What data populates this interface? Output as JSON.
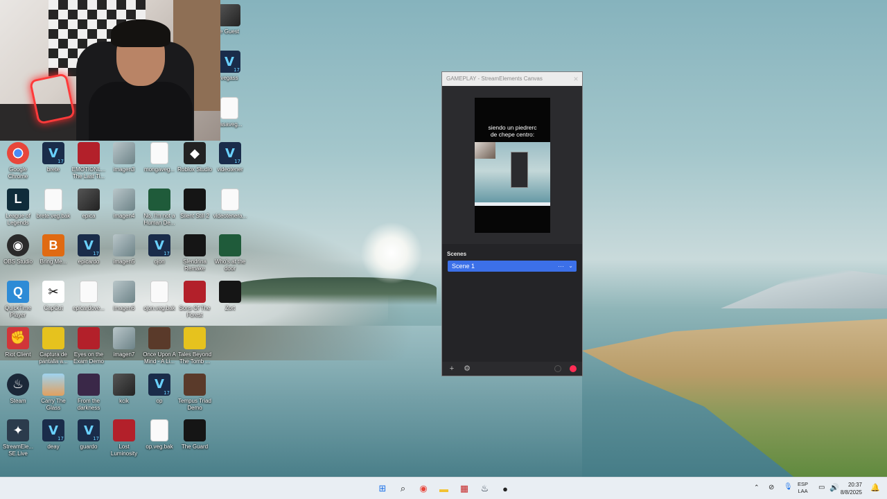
{
  "desktop": {
    "icons": [
      {
        "label": "Google Chrome",
        "kind": "chrome",
        "col": 0,
        "row": 0
      },
      {
        "label": "brete",
        "kind": "vegas",
        "col": 1,
        "row": 0
      },
      {
        "label": "EMOTIONL... The Last Ti...",
        "kind": "app-red",
        "col": 2,
        "row": 0
      },
      {
        "label": "imagen3",
        "kind": "thumb",
        "col": 3,
        "row": 0
      },
      {
        "label": "mongaveg...",
        "kind": "file",
        "col": 4,
        "row": 0
      },
      {
        "label": "Roblox Studio",
        "kind": "roblox",
        "col": 5,
        "row": 0
      },
      {
        "label": "videotener",
        "kind": "vegas",
        "col": 6,
        "row": 0
      },
      {
        "label": "League of Legends",
        "kind": "lol",
        "col": 0,
        "row": 1
      },
      {
        "label": "brete.veg.bak",
        "kind": "file",
        "col": 1,
        "row": 1
      },
      {
        "label": "epica",
        "kind": "thumb-dark",
        "col": 2,
        "row": 1
      },
      {
        "label": "imagen4",
        "kind": "thumb",
        "col": 3,
        "row": 1
      },
      {
        "label": "No, I'm not a Human De...",
        "kind": "app-green",
        "col": 4,
        "row": 1
      },
      {
        "label": "Silent Still 2",
        "kind": "app-black",
        "col": 5,
        "row": 1
      },
      {
        "label": "videotenera...",
        "kind": "file",
        "col": 6,
        "row": 1
      },
      {
        "label": "OBS Studio",
        "kind": "obs",
        "col": 0,
        "row": 2
      },
      {
        "label": "Bring Me...",
        "kind": "app-orange",
        "col": 1,
        "row": 2
      },
      {
        "label": "epicardo",
        "kind": "vegas",
        "col": 2,
        "row": 2
      },
      {
        "label": "imagen5",
        "kind": "thumb",
        "col": 3,
        "row": 2
      },
      {
        "label": "ojon",
        "kind": "vegas",
        "col": 4,
        "row": 2
      },
      {
        "label": "Slendrina Remake",
        "kind": "app-black",
        "col": 5,
        "row": 2
      },
      {
        "label": "Who's at the door",
        "kind": "app-green",
        "col": 6,
        "row": 2
      },
      {
        "label": "QuickTime Player",
        "kind": "quicktime",
        "col": 0,
        "row": 3
      },
      {
        "label": "CapCut",
        "kind": "capcut",
        "col": 1,
        "row": 3
      },
      {
        "label": "epicardove...",
        "kind": "file",
        "col": 2,
        "row": 3
      },
      {
        "label": "imagen6",
        "kind": "thumb",
        "col": 3,
        "row": 3
      },
      {
        "label": "ojon.veg.bak",
        "kind": "file",
        "col": 4,
        "row": 3
      },
      {
        "label": "Sons Of The Forest",
        "kind": "app-red",
        "col": 5,
        "row": 3
      },
      {
        "label": "Zort",
        "kind": "app-black",
        "col": 6,
        "row": 3
      },
      {
        "label": "Riot Client",
        "kind": "riot",
        "col": 0,
        "row": 4
      },
      {
        "label": "Captura de pantalla a...",
        "kind": "app-yellow",
        "col": 1,
        "row": 4
      },
      {
        "label": "Eyes on the Exam Demo",
        "kind": "app-red",
        "col": 2,
        "row": 4
      },
      {
        "label": "imagen7",
        "kind": "thumb",
        "col": 3,
        "row": 4
      },
      {
        "label": "Once Upon A Mind - A Li...",
        "kind": "app-brown",
        "col": 4,
        "row": 4
      },
      {
        "label": "Tales Beyond The Tomb ...",
        "kind": "app-yellow",
        "col": 5,
        "row": 4
      },
      {
        "label": "Steam",
        "kind": "steam",
        "col": 0,
        "row": 5
      },
      {
        "label": "Carry The Glass",
        "kind": "app-sky",
        "col": 1,
        "row": 5
      },
      {
        "label": "From the darkness",
        "kind": "app-purple",
        "col": 2,
        "row": 5
      },
      {
        "label": "kcik",
        "kind": "thumb-dark",
        "col": 3,
        "row": 5
      },
      {
        "label": "op",
        "kind": "vegas",
        "col": 4,
        "row": 5
      },
      {
        "label": "Tempus Triad Demo",
        "kind": "app-brown",
        "col": 5,
        "row": 5
      },
      {
        "label": "StreamEle... SE.Live",
        "kind": "selive",
        "col": 0,
        "row": 6
      },
      {
        "label": "deay",
        "kind": "vegas",
        "col": 1,
        "row": 6
      },
      {
        "label": "guardo",
        "kind": "vegas",
        "col": 2,
        "row": 6
      },
      {
        "label": "Lost Luminosity",
        "kind": "app-red",
        "col": 3,
        "row": 6
      },
      {
        "label": "op.veg.bak",
        "kind": "file",
        "col": 4,
        "row": 6
      },
      {
        "label": "The Guard",
        "kind": "app-black",
        "col": 5,
        "row": 6
      }
    ],
    "top_right_icons": [
      {
        "label": "e Guest",
        "kind": "thumb-dark"
      },
      {
        "label": "vegass",
        "kind": "vegas"
      },
      {
        "label": "gasaveg...",
        "kind": "file"
      }
    ]
  },
  "canvas_window": {
    "title": "GAMEPLAY - StreamElements Canvas",
    "close_glyph": "✕",
    "preview_caption_line1": "siendo un piedrerc",
    "preview_caption_line2": "de chepe centro:",
    "scenes_heading": "Scenes",
    "scenes": [
      {
        "name": "Scene 1",
        "selected": true
      }
    ],
    "scene_more_glyph": "···",
    "scene_chevron_glyph": "⌄",
    "add_glyph": "+",
    "settings_glyph": "⚙",
    "record_color": "#ff2d55",
    "accent": "#3c70e8"
  },
  "taskbar": {
    "pinned": [
      {
        "name": "start-button",
        "glyph": "⊞",
        "color": "#1e73e8"
      },
      {
        "name": "search-button",
        "glyph": "⌕",
        "color": "#222222"
      },
      {
        "name": "chrome",
        "glyph": "◉",
        "color": "#e8463b"
      },
      {
        "name": "file-explorer",
        "glyph": "▬",
        "color": "#f2c232"
      },
      {
        "name": "app-red",
        "glyph": "▦",
        "color": "#c62828"
      },
      {
        "name": "steam",
        "glyph": "♨",
        "color": "#1b2838"
      },
      {
        "name": "obs",
        "glyph": "●",
        "color": "#222222"
      }
    ],
    "language_top": "ESP",
    "language_bottom": "LAA",
    "time": "20:37",
    "date": "8/8/2025"
  }
}
